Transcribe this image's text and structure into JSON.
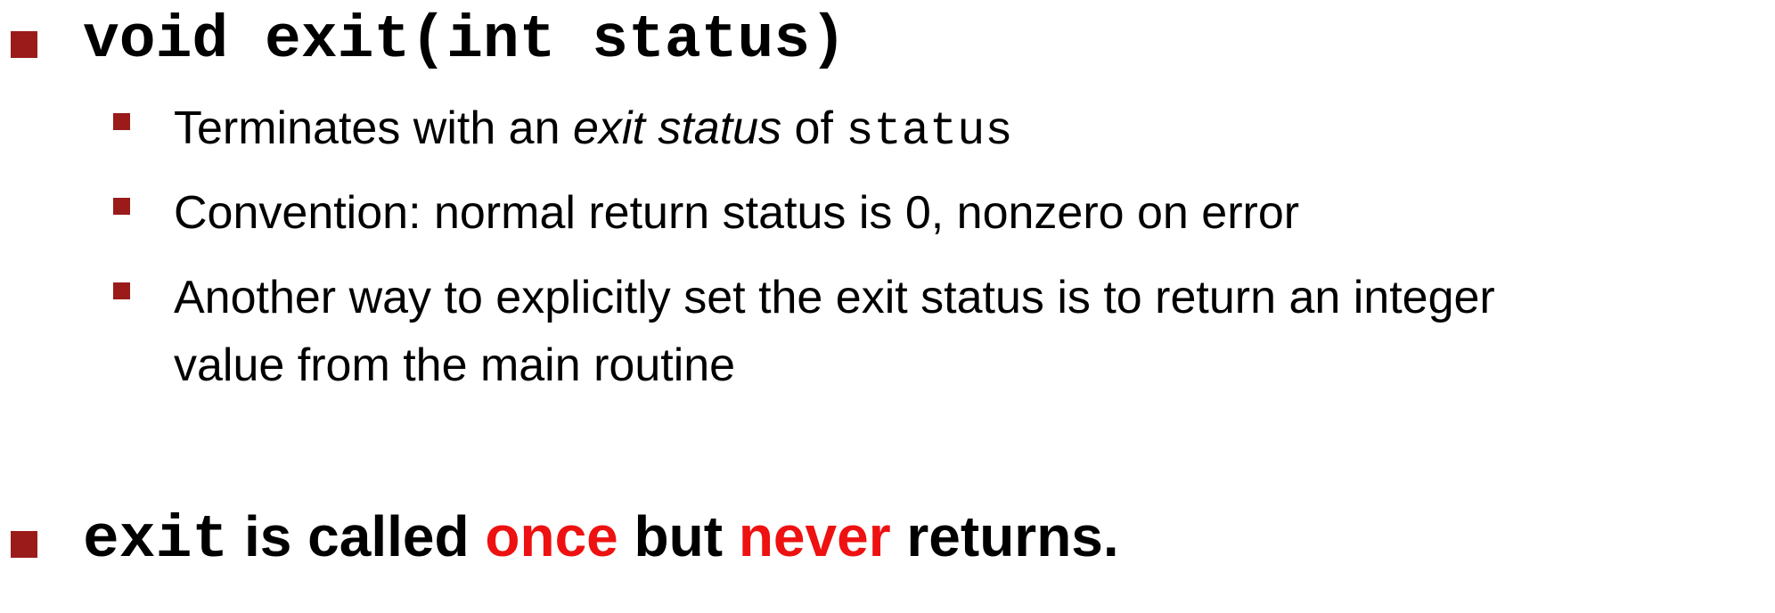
{
  "heading1": {
    "code": "void exit(int status)"
  },
  "subbullets": {
    "b1": {
      "text1": "Terminates with an ",
      "italic": "exit status",
      "text2": " of ",
      "code": "status"
    },
    "b2": {
      "text": "Convention: normal return status is 0, nonzero on error"
    },
    "b3": {
      "line1": "Another way to explicitly set the exit status is to return an integer",
      "line2": "value from the main routine"
    }
  },
  "heading2": {
    "code": "exit",
    "text1": " is called ",
    "highlight1": "once",
    "text2": " but ",
    "highlight2": "never",
    "text3": " returns."
  },
  "colors": {
    "bullet": "#9b1b1b",
    "highlight": "#ee1111",
    "text": "#000000"
  }
}
